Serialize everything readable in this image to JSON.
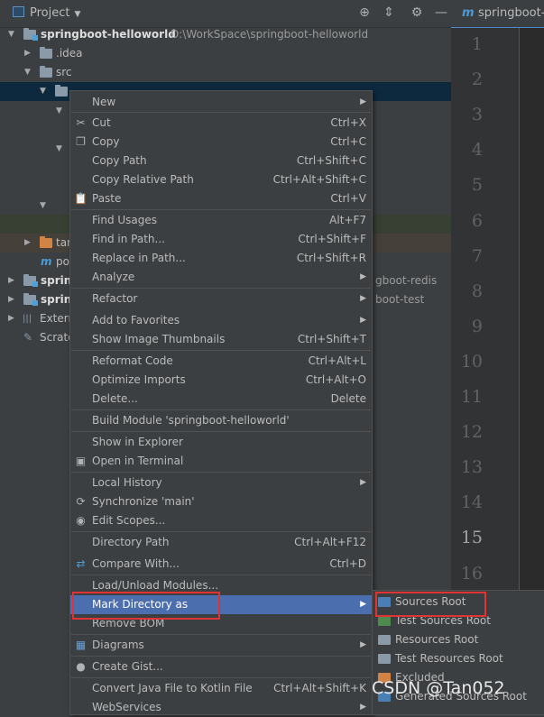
{
  "project_pane": {
    "title": "Project",
    "tree": [
      {
        "name": "springboot-helloworld",
        "path": "D:\\WorkSpace\\springboot-helloworld"
      },
      {
        "name": ".idea"
      },
      {
        "name": "src"
      },
      {
        "name": "tar"
      },
      {
        "name": "po"
      },
      {
        "name": "spring",
        "suffix": "gboot-redis"
      },
      {
        "name": "spring",
        "suffix": "boot-test"
      },
      {
        "name": "Extern"
      },
      {
        "name": "Scrato"
      }
    ]
  },
  "editor": {
    "tab_icon": "m",
    "tab_title": "springboot-",
    "line_numbers": [
      "1",
      "2",
      "3",
      "4",
      "5",
      "6",
      "7",
      "8",
      "9",
      "10",
      "11",
      "12",
      "13",
      "14",
      "15",
      "16"
    ],
    "current_line": "15"
  },
  "context_menu": {
    "items": [
      {
        "label": "New",
        "shortcut": ""
      },
      {
        "label": "Cut",
        "shortcut": "Ctrl+X"
      },
      {
        "label": "Copy",
        "shortcut": "Ctrl+C"
      },
      {
        "label": "Copy Path",
        "shortcut": "Ctrl+Shift+C"
      },
      {
        "label": "Copy Relative Path",
        "shortcut": "Ctrl+Alt+Shift+C"
      },
      {
        "label": "Paste",
        "shortcut": "Ctrl+V"
      },
      {
        "label": "Find Usages",
        "shortcut": "Alt+F7"
      },
      {
        "label": "Find in Path...",
        "shortcut": "Ctrl+Shift+F"
      },
      {
        "label": "Replace in Path...",
        "shortcut": "Ctrl+Shift+R"
      },
      {
        "label": "Analyze",
        "shortcut": ""
      },
      {
        "label": "Refactor",
        "shortcut": ""
      },
      {
        "label": "Add to Favorites",
        "shortcut": ""
      },
      {
        "label": "Show Image Thumbnails",
        "shortcut": "Ctrl+Shift+T"
      },
      {
        "label": "Reformat Code",
        "shortcut": "Ctrl+Alt+L"
      },
      {
        "label": "Optimize Imports",
        "shortcut": "Ctrl+Alt+O"
      },
      {
        "label": "Delete...",
        "shortcut": "Delete"
      },
      {
        "label": "Build Module 'springboot-helloworld'",
        "shortcut": ""
      },
      {
        "label": "Show in Explorer",
        "shortcut": ""
      },
      {
        "label": "Open in Terminal",
        "shortcut": ""
      },
      {
        "label": "Local History",
        "shortcut": ""
      },
      {
        "label": "Synchronize 'main'",
        "shortcut": ""
      },
      {
        "label": "Edit Scopes...",
        "shortcut": ""
      },
      {
        "label": "Directory Path",
        "shortcut": "Ctrl+Alt+F12"
      },
      {
        "label": "Compare With...",
        "shortcut": "Ctrl+D"
      },
      {
        "label": "Load/Unload Modules...",
        "shortcut": ""
      },
      {
        "label": "Mark Directory as",
        "shortcut": ""
      },
      {
        "label": "Remove BOM",
        "shortcut": ""
      },
      {
        "label": "Diagrams",
        "shortcut": ""
      },
      {
        "label": "Create Gist...",
        "shortcut": ""
      },
      {
        "label": "Convert Java File to Kotlin File",
        "shortcut": "Ctrl+Alt+Shift+K"
      },
      {
        "label": "WebServices",
        "shortcut": ""
      }
    ]
  },
  "submenu": {
    "items": [
      {
        "label": "Sources Root",
        "color": "#4a7fb5"
      },
      {
        "label": "Test Sources Root",
        "color": "#4e8a4e"
      },
      {
        "label": "Resources Root",
        "color": "#8a9aa8"
      },
      {
        "label": "Test Resources Root",
        "color": "#8a9aa8"
      },
      {
        "label": "Excluded",
        "color": "#d28445"
      },
      {
        "label": "Generated Sources Root",
        "color": "#4a7fb5"
      }
    ]
  },
  "watermark": "CSDN @Tan052",
  "colors": {
    "selection": "#4b6eaf",
    "highlight_box": "#e03333",
    "panel_bg": "#3c3f41",
    "editor_bg": "#2b2b2b"
  }
}
